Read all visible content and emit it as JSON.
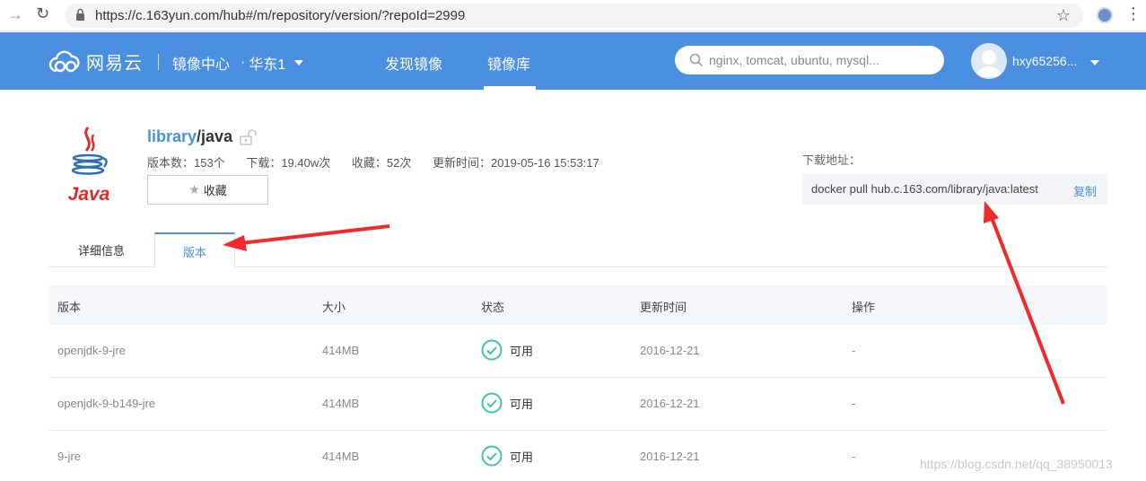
{
  "browser": {
    "url": "https://c.163yun.com/hub#/m/repository/version/?repoId=2999"
  },
  "header": {
    "logo_text": "网易云",
    "hub_name": "镜像中心",
    "region": "华东1",
    "nav": [
      "发现镜像",
      "镜像库"
    ],
    "active_nav": "镜像库",
    "search_placeholder": "nginx, tomcat, ubuntu, mysql...",
    "username": "hxy65256...",
    "accent_color": "#4a8fe0"
  },
  "repo": {
    "namespace": "library",
    "slash": "/",
    "name": "java",
    "version_count": "版本数：153个",
    "downloads": "下载：19.40w次",
    "favorites": "收藏：52次",
    "updated": "更新时间：2019-05-16 15:53:17",
    "favorite_button": "收藏",
    "download_label": "下载地址：",
    "download_command": "docker pull hub.c.163.com/library/java:latest",
    "copy_label": "复制"
  },
  "tabs": [
    "详细信息",
    "版本"
  ],
  "active_tab": "版本",
  "table": {
    "headers": [
      "版本",
      "大小",
      "状态",
      "更新时间",
      "操作"
    ],
    "rows": [
      {
        "version": "openjdk-9-jre",
        "size": "414MB",
        "status": "可用",
        "updated": "2016-12-21",
        "action": "-"
      },
      {
        "version": "openjdk-9-b149-jre",
        "size": "414MB",
        "status": "可用",
        "updated": "2016-12-21",
        "action": "-"
      },
      {
        "version": "9-jre",
        "size": "414MB",
        "status": "可用",
        "updated": "2016-12-21",
        "action": "-"
      }
    ]
  },
  "status_color": "#3fc7a0",
  "annotation_color": "#f02a2a",
  "watermark": "https://blog.csdn.net/qq_38950013"
}
